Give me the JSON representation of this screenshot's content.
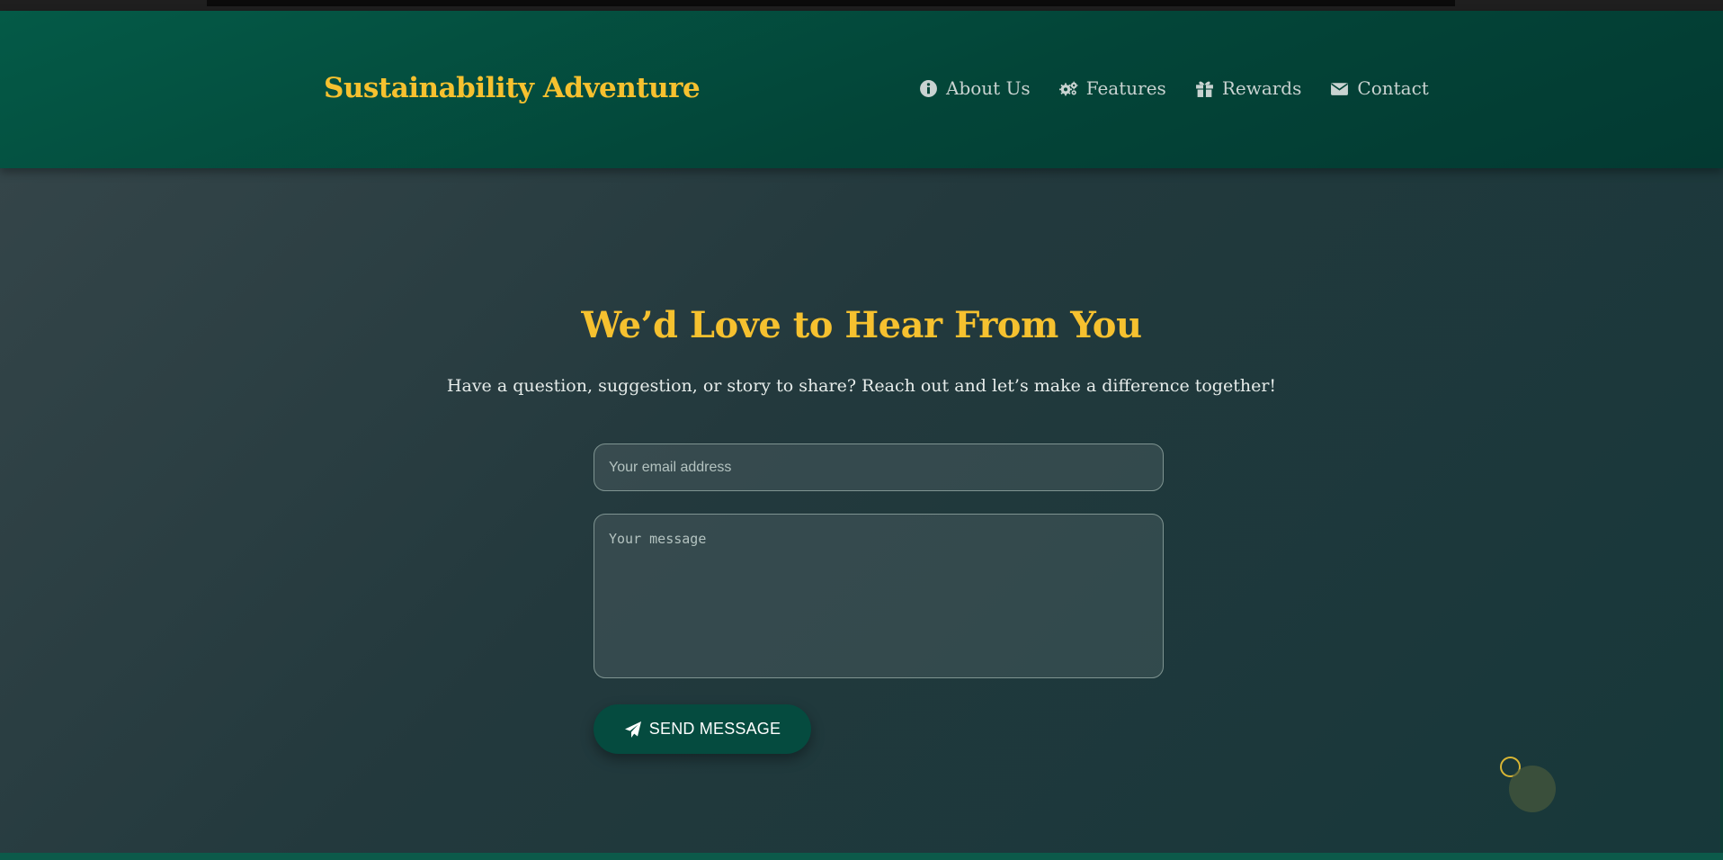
{
  "header": {
    "brand": "Sustainability Adventure",
    "nav": [
      {
        "label": "About Us",
        "icon": "info-circle-icon"
      },
      {
        "label": "Features",
        "icon": "gears-icon"
      },
      {
        "label": "Rewards",
        "icon": "gift-icon"
      },
      {
        "label": "Contact",
        "icon": "envelope-icon"
      }
    ]
  },
  "contact": {
    "title": "We’d Love to Hear From You",
    "subtitle": "Have a question, suggestion, or story to share? Reach out and let’s make a difference together!",
    "email_placeholder": "Your email address",
    "message_placeholder": "Your message",
    "send_label": "SEND MESSAGE",
    "send_icon": "paper-plane-icon"
  },
  "colors": {
    "accent": "#f6c12f",
    "header_bg": "#034538",
    "button_bg": "#054b3f"
  }
}
